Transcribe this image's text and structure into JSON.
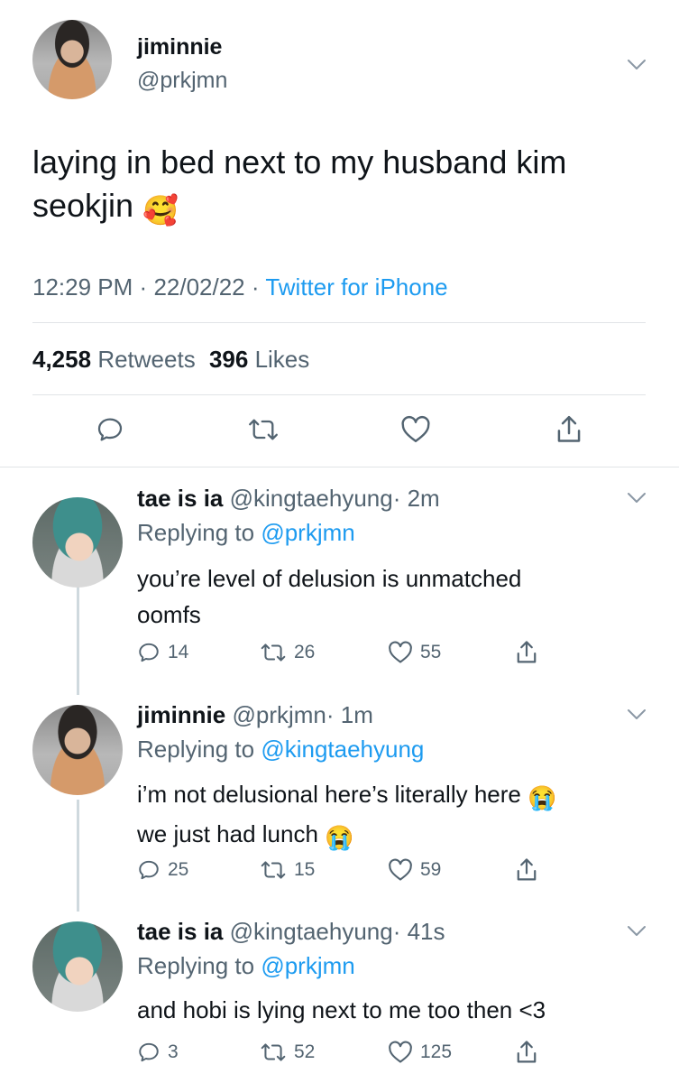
{
  "main_tweet": {
    "display_name": "jiminnie",
    "handle": "@prkjmn",
    "text": "laying in bed next to my husband kim seokjin",
    "emoji": "🥰",
    "time": "12:29 PM",
    "sep1": "·",
    "date": "22/02/22",
    "sep2": "·",
    "source": "Twitter for iPhone",
    "retweets_count": "4,258",
    "retweets_label": "Retweets",
    "likes_count": "396",
    "likes_label": "Likes"
  },
  "replies": [
    {
      "display_name": "tae is ia",
      "handle": "@kingtaehyung",
      "time": "· 2m",
      "replying_prefix": "Replying to",
      "replying_to": "@prkjmn",
      "text_line1": "you’re level of delusion is unmatched",
      "text_line2": "oomfs",
      "replies": "14",
      "retweets": "26",
      "likes": "55"
    },
    {
      "display_name": "jiminnie",
      "handle": "@prkjmn",
      "time": "· 1m",
      "replying_prefix": "Replying to",
      "replying_to": "@kingtaehyung",
      "text_line1": "i’m not delusional here’s literally here",
      "text_line2": "we just had lunch",
      "emoji": "😭",
      "replies": "25",
      "retweets": "15",
      "likes": "59"
    },
    {
      "display_name": "tae is ia",
      "handle": "@kingtaehyung",
      "time": "· 41s",
      "replying_prefix": "Replying to",
      "replying_to": "@prkjmn",
      "text_line1": "and hobi is lying next to me too then <3",
      "replies": "3",
      "retweets": "52",
      "likes": "125"
    }
  ],
  "colors": {
    "link": "#1d9bf0",
    "muted": "#536471",
    "text": "#0f1419",
    "divider": "#e1e4e7"
  },
  "icons": [
    "chevron-down-icon",
    "reply-icon",
    "retweet-icon",
    "like-icon",
    "share-icon"
  ]
}
